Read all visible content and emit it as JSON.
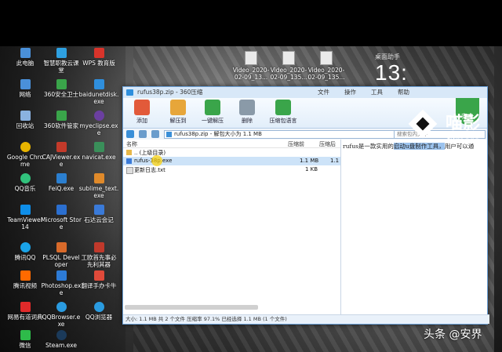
{
  "desktop": {
    "icons": [
      {
        "label": "此电脑",
        "color": "#4a90d9"
      },
      {
        "label": "智慧职教云课堂",
        "color": "#2ea0e0"
      },
      {
        "label": "WPS 教育版",
        "color": "#d9342b"
      },
      {
        "label": "联想电脑管家",
        "color": "#2a6ed8"
      },
      {
        "label": "网络",
        "color": "#4a90d9"
      },
      {
        "label": "360安全卫士",
        "color": "#3aa54a"
      },
      {
        "label": "baidunetdisk.exe",
        "color": "#2f8fdd"
      },
      {
        "label": "回收站",
        "color": "#8ab2e0"
      },
      {
        "label": "360软件管家",
        "color": "#3aa54a"
      },
      {
        "label": "myeclipse.exe",
        "color": "#6b3fa0"
      },
      {
        "label": "Google Chrome",
        "color": "#e8b400"
      },
      {
        "label": "CAJViewer.exe",
        "color": "#c43a2a"
      },
      {
        "label": "navicat.exe",
        "color": "#3a8f5a"
      },
      {
        "label": "QQ音乐",
        "color": "#31c27c"
      },
      {
        "label": "FeiQ.exe",
        "color": "#2b7fd0"
      },
      {
        "label": "sublime_text.exe",
        "color": "#e08a2a"
      },
      {
        "label": "TeamViewer 14",
        "color": "#0e8ee9"
      },
      {
        "label": "Microsoft Store",
        "color": "#2b6fd0"
      },
      {
        "label": "石达云会记",
        "color": "#3a7ad8"
      },
      {
        "label": "腾讯QQ",
        "color": "#1aa3e8"
      },
      {
        "label": "PLSQL Developer",
        "color": "#d96a2a"
      },
      {
        "label": "工欧首先事必先利其器",
        "color": "#c0392b"
      },
      {
        "label": "腾讯视频",
        "color": "#ff6a00"
      },
      {
        "label": "Photoshop.exe",
        "color": "#2d7bd6"
      },
      {
        "label": "翻译手办卡牛",
        "color": "#e04a3a"
      },
      {
        "label": "网易有道词典",
        "color": "#e02a2a"
      },
      {
        "label": "QQBrowser.exe",
        "color": "#2a9be0"
      },
      {
        "label": "QQ浏览器",
        "color": "#2a9be0"
      },
      {
        "label": "微信",
        "color": "#2ebb4a"
      },
      {
        "label": "Steam.exe",
        "color": "#1b3a5a"
      }
    ],
    "top_files": [
      "Video_2020-02-09_13...",
      "Video_2020-02-09_135...",
      "Video_2020-02-09_135..."
    ],
    "clock": {
      "header": "桌面助手",
      "time": "13:"
    }
  },
  "window": {
    "title": "rufus38p.zip - 360压缩",
    "menu": [
      "文件",
      "操作",
      "工具",
      "帮助"
    ],
    "toolbar": [
      {
        "label": "添加",
        "color": "#e25a3a"
      },
      {
        "label": "解压到",
        "color": "#e7a63a"
      },
      {
        "label": "一键解压",
        "color": "#3aa54a"
      },
      {
        "label": "删除",
        "color": "#8a9aa8"
      },
      {
        "label": "压缩包语言",
        "color": "#3aa54a"
      }
    ],
    "safe_label": "安全",
    "address": "rufus38p.zip - 解包大小为 1.1 MB",
    "search_placeholder": "搜索包内文件",
    "columns": {
      "name": "名称",
      "compressed": "压缩前",
      "after": "压缩后"
    },
    "files": [
      {
        "name": ".. (上级目录)",
        "compressed": "",
        "after": ""
      },
      {
        "name": "rufus-38p.exe",
        "compressed": "1.1 MB",
        "after": "1.1"
      },
      {
        "name": "更新日志.txt",
        "compressed": "1 KB",
        "after": ""
      }
    ],
    "preview": {
      "text_before": "rufus是一款实用的",
      "text_highlight": "启动u盘制作工具，",
      "text_after": "用户可以通"
    },
    "status": "大小: 1.1 MB 共 2 个文件 压缩率 97.1% 已经选择 1.1 MB (1 个文件)"
  },
  "overlay": {
    "brand_cn": "喵影",
    "brand_en": "filmore",
    "watermark": "头条 @安界"
  }
}
